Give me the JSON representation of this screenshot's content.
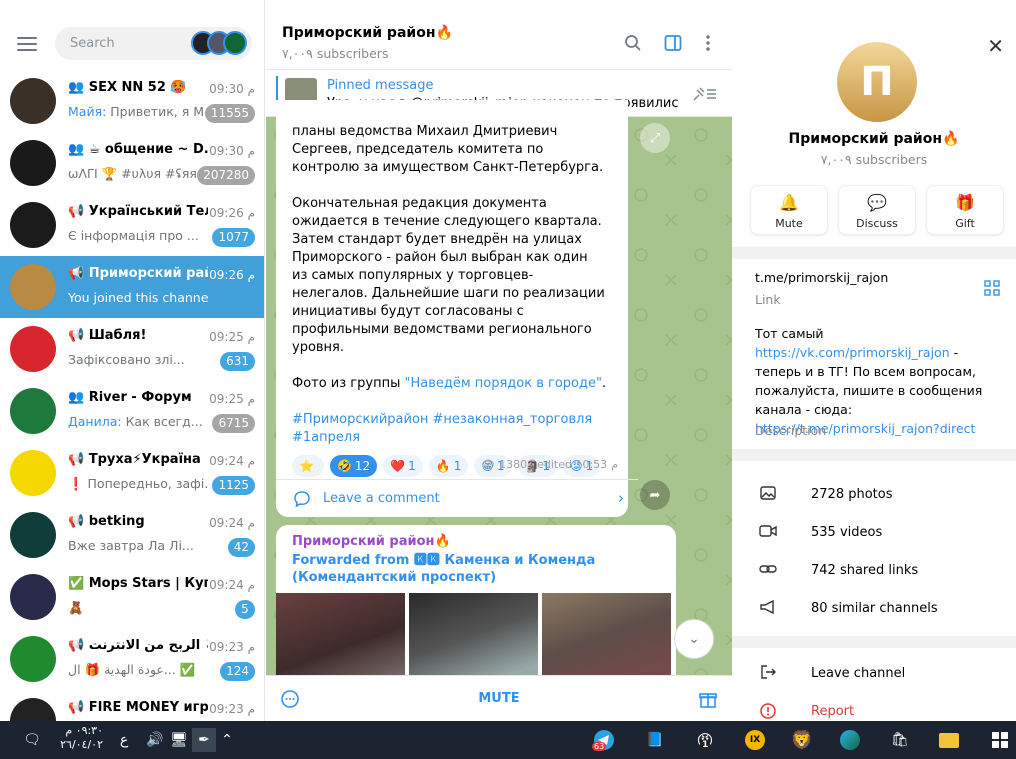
{
  "search": {
    "placeholder": "Search"
  },
  "window": {
    "minimize": "—",
    "maximize": "❐",
    "close": "✕"
  },
  "chats": [
    {
      "icon": "👥",
      "name": "SEX NN 52 🥵",
      "time": "09:30",
      "author": "Майя: ",
      "preview": "Приветик, я М...",
      "badge": "11555",
      "badge_style": "muted",
      "avatar_color": "#3a3028"
    },
    {
      "icon": "👥",
      "name": "☕ общение ~ D...",
      "time": "09:30",
      "author": "",
      "preview": "ωΛΓΙ 🏆 #υλυя #ʢяя:",
      "badge": "207280",
      "badge_style": "muted",
      "avatar_color": "#1a1a1a"
    },
    {
      "icon": "📢",
      "name": "Український Тел...",
      "time": "09:26",
      "author": "",
      "preview": "Є інформація про ...",
      "badge": "1077",
      "badge_style": "blue",
      "avatar_color": "#1b1b1b"
    },
    {
      "icon": "📢",
      "name": "Приморский рай...",
      "time": "09:26",
      "author": "",
      "preview": "You joined this channel",
      "badge": "",
      "badge_style": "",
      "avatar_color": "#b98a42"
    },
    {
      "icon": "📢",
      "name": "Шабля!",
      "time": "09:25",
      "author": "",
      "preview": "Зафіксовано злі...",
      "badge": "631",
      "badge_style": "blue",
      "avatar_color": "#d7262d"
    },
    {
      "icon": "👥",
      "name": "River - Форум",
      "time": "09:25",
      "author": "Данила: ",
      "preview": "Как всегд...",
      "badge": "6715",
      "badge_style": "muted",
      "avatar_color": "#1e7a3c"
    },
    {
      "icon": "📢",
      "name": "Труха⚡Україна",
      "time": "09:24",
      "author": "",
      "preview": "❗ Попередньо, зафі...",
      "badge": "1125",
      "badge_style": "blue",
      "avatar_color": "#f5d800"
    },
    {
      "icon": "📢",
      "name": "betking",
      "time": "09:24",
      "author": "",
      "preview": "Вже завтра Ла Лі...",
      "badge": "42",
      "badge_style": "blue",
      "avatar_color": "#0f3d3a"
    },
    {
      "icon": "✅",
      "name": "Mops Stars | Куп...",
      "time": "09:24",
      "author": "",
      "preview": "🧸",
      "badge": "5",
      "badge_style": "blue",
      "avatar_color": "#2a2a4a"
    },
    {
      "icon": "📢",
      "name": "الربح من الانترنت 💸",
      "time": "09:23",
      "author": "",
      "preview": "عودة الهدية 🎁 ال... ✅",
      "badge": "124",
      "badge_style": "blue",
      "avatar_color": "#1f8a2e"
    },
    {
      "icon": "📢",
      "name": "FIRE MONEY игры",
      "time": "09:23",
      "author": "",
      "preview": "",
      "badge": "",
      "badge_style": "",
      "avatar_color": "#222"
    }
  ],
  "time_prefix": "م",
  "channel": {
    "title": "Приморский район🔥",
    "subscribers": "٧,٠٠٩ subscribers"
  },
  "pinned": {
    "label": "Pinned message",
    "text": "Ура, у нас в @primorskij_rajon наконец-то появились к..."
  },
  "post": {
    "p1": "планы ведомства Михаил Дмитриевич Сергеев, председатель комитета по контролю за имуществом Санкт-Петербурга.",
    "p2": "Окончательная редакция документа ожидается в течение следующего квартала.  Затем стандарт будет внедрён на улицах Приморского - район был выбран как один из самых популярных у торговцев-нелегалов. Дальнейшие шаги по реализации инициативы будут согласованы с профильными ведомствами регионального уровня.",
    "p3_prefix": "Фото из группы ",
    "p3_link": "\"Наведём порядок в городе\"",
    "p3_suffix": ".",
    "hashtags": "#Приморскийрайон #незаконная_торговля #1апреля",
    "reactions": [
      {
        "emoji": "⭐",
        "count": ""
      },
      {
        "emoji": "🤣",
        "count": "12",
        "on": true
      },
      {
        "emoji": "❤️",
        "count": "1"
      },
      {
        "emoji": "🔥",
        "count": "1"
      },
      {
        "emoji": "😁",
        "count": "1"
      },
      {
        "emoji": "🗿",
        "count": "1"
      },
      {
        "emoji": "😡",
        "count": "1"
      }
    ],
    "views": "1380",
    "edited": "edited 10:53",
    "leave_comment": "Leave a comment"
  },
  "post2": {
    "channel": "Приморский район🔥",
    "forwarded": "Forwarded from 🅺🅺 Каменка и Коменда (Комендантский проспект)"
  },
  "bottom": {
    "mute": "MUTE"
  },
  "profile": {
    "title": "Приморский район🔥",
    "subscribers": "٧,٠٠٩ subscribers",
    "actions": [
      {
        "icon": "bell-icon",
        "label": "Mute"
      },
      {
        "icon": "chat-icon",
        "label": "Discuss"
      },
      {
        "icon": "gift-icon",
        "label": "Gift"
      }
    ],
    "link": "t.me/primorskij_rajon",
    "link_caption": "Link",
    "desc_1": "Тот самый ",
    "desc_link1": "https://vk.com/primorskij_rajon",
    "desc_2": " - теперь и в ТГ! По всем вопросам, пожалуйста, пишите в сообщения канала - сюда: ",
    "desc_link2": "https://t.me/primorskij_rajon?direct",
    "desc_caption": "Description",
    "media": [
      {
        "icon": "photo-icon",
        "label": "2728 photos"
      },
      {
        "icon": "video-icon",
        "label": "535 videos"
      },
      {
        "icon": "link-icon",
        "label": "742 shared links"
      },
      {
        "icon": "megaphone-icon",
        "label": "80 similar channels"
      }
    ],
    "leave": "Leave channel",
    "report": "Report"
  },
  "taskbar": {
    "lang": "ع",
    "time": "٠٩:٣٠ م",
    "date": "٢٦/٠٤/٠٢",
    "telegram_badge": "63",
    "app_badge": "1"
  }
}
